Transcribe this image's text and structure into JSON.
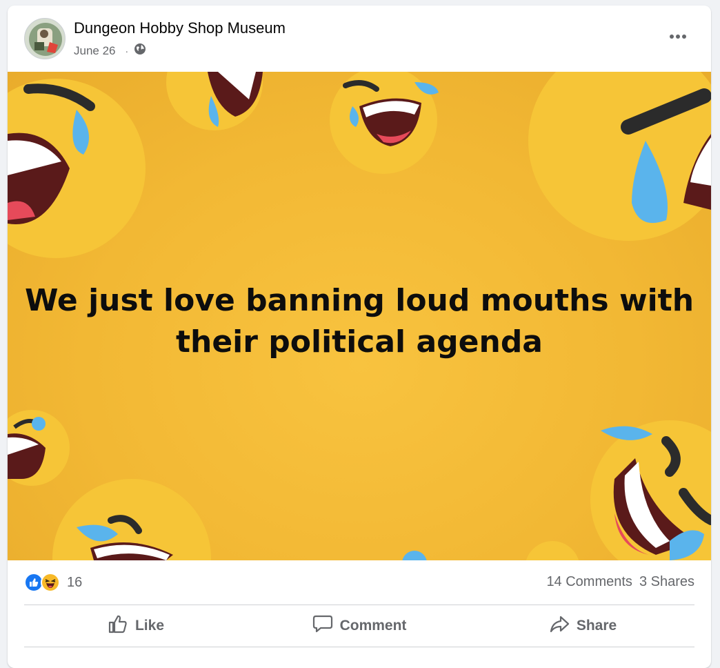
{
  "post": {
    "page_name": "Dungeon Hobby Shop Museum",
    "date": "June 26",
    "audience_icon": "globe-icon",
    "more_icon": "more-options-icon"
  },
  "image": {
    "caption": "We just love banning loud mouths with\ntheir political agenda",
    "background_color": "#f5bb35",
    "decorations": "laughing-crying-emoji"
  },
  "stats": {
    "reaction_icons": [
      "like-reaction-icon",
      "haha-reaction-icon"
    ],
    "reaction_count": "16",
    "comments": "14 Comments",
    "shares": "3 Shares"
  },
  "actions": {
    "like": "Like",
    "comment": "Comment",
    "share": "Share"
  },
  "colors": {
    "like_blue": "#1877f2",
    "haha_yellow": "#f7b928",
    "secondary_text": "#65676b"
  }
}
